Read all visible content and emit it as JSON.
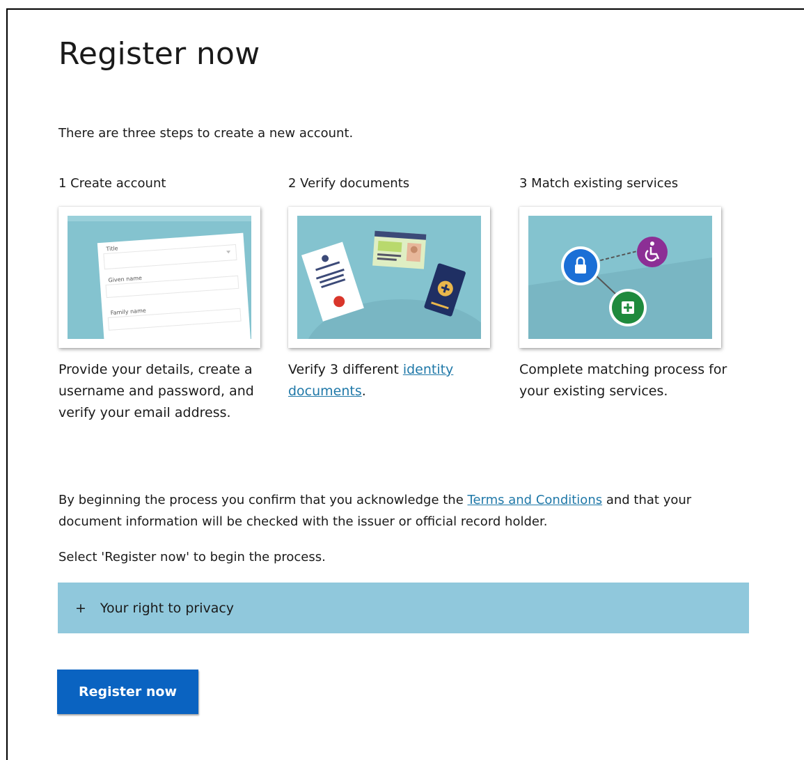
{
  "page": {
    "title": "Register now",
    "intro": "There are three steps to create a new account."
  },
  "steps": [
    {
      "title": "1 Create account",
      "description": "Provide your details, create a username and password, and verify your email address.",
      "illustration": {
        "field_1": "Title",
        "field_2": "Given name",
        "field_3": "Family name"
      }
    },
    {
      "title": "2 Verify documents",
      "description_before": "Verify 3 different ",
      "description_link": "identity documents",
      "description_after": "."
    },
    {
      "title": "3 Match existing services",
      "description": "Complete matching process for your existing services."
    }
  ],
  "consent": {
    "before": "By beginning the process you confirm that you acknowledge the ",
    "link": "Terms and Conditions",
    "after": " and that your document information will be checked with the issuer or official record holder."
  },
  "instruction": "Select 'Register now' to begin the process.",
  "accordion": {
    "icon": "+",
    "label": "Your right to privacy"
  },
  "register_button": {
    "label": "Register now"
  },
  "colors": {
    "illustration_bg": "#84c3cf",
    "accordion_bg": "#90c8dc",
    "button_bg": "#0a63c1",
    "link": "#1f78a8",
    "lock_node": "#1b6fd6",
    "accessibility_node": "#8c2f95",
    "health_node": "#1f8a3d"
  }
}
